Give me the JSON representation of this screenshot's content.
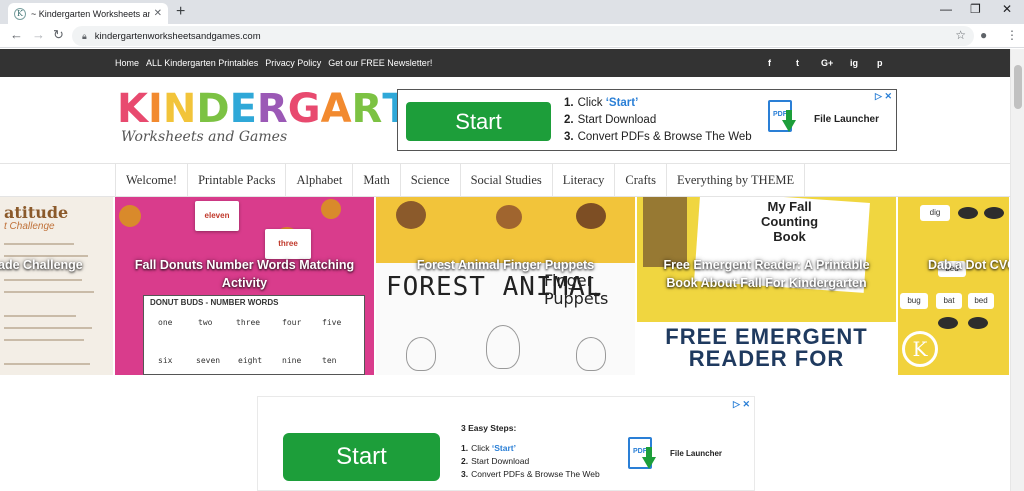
{
  "browser": {
    "tab_title": "~ Kindergarten Worksheets and G",
    "favicon_letter": "K",
    "url": "kindergartenworksheetsandgames.com"
  },
  "topnav": {
    "items": [
      "Home",
      "ALL Kindergarten Printables",
      "Privacy Policy",
      "Get our FREE Newsletter!"
    ],
    "social": [
      "f",
      "t",
      "G+",
      "ig",
      "p"
    ]
  },
  "logo": {
    "letters": [
      "K",
      "I",
      "N",
      "D",
      "E",
      "R",
      "G",
      "A",
      "R",
      "T",
      "E",
      "N"
    ],
    "colors": [
      "#e84a6f",
      "#f28a2f",
      "#f2c43a",
      "#7cc243",
      "#2fa8d8",
      "#9b59b6",
      "#e84a6f",
      "#f28a2f",
      "#7cc243",
      "#2fa8d8",
      "#f2c43a",
      "#e84a6f"
    ],
    "subtitle": "Worksheets and Games"
  },
  "ad_top": {
    "button": "Start",
    "steps": [
      {
        "num": "1.",
        "pre": "Click ",
        "quote": "‘Start’"
      },
      {
        "num": "2.",
        "pre": "Start Download",
        "quote": ""
      },
      {
        "num": "3.",
        "pre": "Convert PDFs & Browse The Web",
        "quote": ""
      }
    ],
    "launcher": "File Launcher",
    "pdf": "PDF",
    "close": "▷ ✕"
  },
  "mainnav": {
    "items": [
      "Welcome!",
      "Printable Packs",
      "Alphabet",
      "Math",
      "Science",
      "Social Studies",
      "Literacy",
      "Crafts",
      "Everything by THEME"
    ]
  },
  "slides": [
    {
      "title": "ade Challenge",
      "header1": "atitude",
      "header2": "t Challenge"
    },
    {
      "title": "Fall Donuts Number Words Matching Activity",
      "sheet_title": "DONUT BUDS - NUMBER WORDS",
      "words": [
        "one",
        "two",
        "three",
        "four",
        "five",
        "six",
        "seven",
        "eight",
        "nine",
        "ten"
      ],
      "cards": [
        "eleven",
        "three"
      ]
    },
    {
      "title": "Forest Animal Finger Puppets",
      "big_left": "FOREST ANIMAL",
      "big_right_1": "Finger",
      "big_right_2": "Puppets"
    },
    {
      "title": "Free Emergent Reader: A Printable Book About Fall For Kindergarten",
      "book_1": "My Fall",
      "book_2": "Counting",
      "book_3": "Book",
      "banner_1": "FREE EMERGENT",
      "banner_2": "READER FOR"
    },
    {
      "title": "Dab a Dot CVC W",
      "cards": [
        "dig",
        "bed",
        "bug",
        "bat",
        "bed",
        "dog"
      ]
    }
  ],
  "ad_bottom": {
    "heading": "3 Easy Steps:",
    "button": "Start",
    "steps": [
      {
        "num": "1.",
        "pre": "Click ",
        "quote": "‘Start’"
      },
      {
        "num": "2.",
        "pre": "Start Download",
        "quote": ""
      },
      {
        "num": "3.",
        "pre": "Convert PDFs & Browse The Web",
        "quote": ""
      }
    ],
    "launcher": "File Launcher",
    "pdf": "PDF",
    "close": "▷ ✕"
  }
}
